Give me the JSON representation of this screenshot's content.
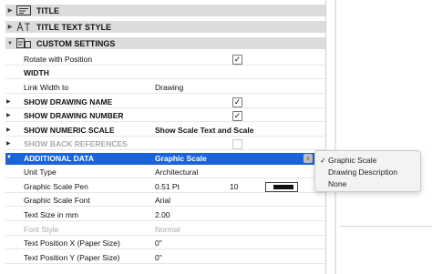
{
  "groups": {
    "title": "TITLE",
    "title_text_style": "TITLE TEXT STYLE",
    "custom_settings": "CUSTOM SETTINGS"
  },
  "rows": {
    "rotate_with_position": {
      "label": "Rotate with Position",
      "checked": true
    },
    "width": {
      "label": "WIDTH"
    },
    "link_width_to": {
      "label": "Link Width to",
      "value": "Drawing"
    },
    "show_drawing_name": {
      "label": "SHOW DRAWING NAME",
      "checked": true
    },
    "show_drawing_number": {
      "label": "SHOW DRAWING NUMBER",
      "checked": true
    },
    "show_numeric_scale": {
      "label": "SHOW NUMERIC SCALE",
      "value": "Show Scale Text and Scale"
    },
    "show_back_references": {
      "label": "SHOW BACK REFERENCES",
      "checked": false,
      "disabled": true
    },
    "additional_data": {
      "label": "ADDITIONAL DATA",
      "value": "Graphic Scale"
    },
    "unit_type": {
      "label": "Unit Type",
      "value": "Architectural"
    },
    "graphic_scale_pen": {
      "label": "Graphic Scale Pen",
      "value": "0.51 Pt",
      "pen_number": "10"
    },
    "graphic_scale_font": {
      "label": "Graphic Scale Font",
      "value": "Arial"
    },
    "text_size": {
      "label": "Text Size in mm",
      "value": "2.00"
    },
    "font_style": {
      "label": "Font Style",
      "value": "Normal"
    },
    "text_pos_x": {
      "label": "Text Position X (Paper Size)",
      "value": "0\""
    },
    "text_pos_y": {
      "label": "Text Position Y (Paper Size)",
      "value": "0\""
    }
  },
  "dropdown": {
    "options": [
      "Graphic Scale",
      "Drawing Description",
      "None"
    ],
    "selected": "Graphic Scale"
  },
  "colors": {
    "selection": "#1b64d8",
    "group_header": "#dcdcdc"
  },
  "icons": {
    "title": "title-icon",
    "title_text_style": "text-style-icon",
    "custom_settings": "custom-settings-icon"
  }
}
